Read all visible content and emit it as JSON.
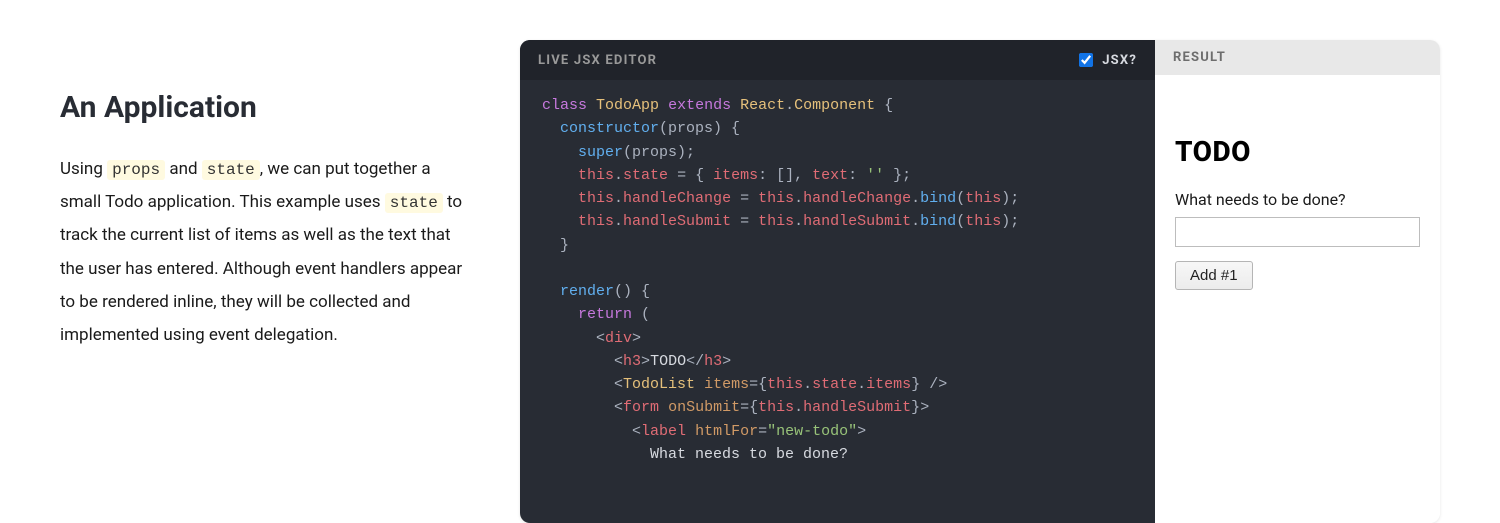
{
  "left": {
    "heading": "An Application",
    "para_pre": "Using ",
    "code1": "props",
    "para_mid1": " and ",
    "code2": "state",
    "para_mid2": ", we can put together a small Todo application. This example uses ",
    "code3": "state",
    "para_post": " to track the current list of items as well as the text that the user has entered. Although event handlers appear to be rendered inline, they will be collected and implemented using event delegation."
  },
  "editor": {
    "title": "LIVE JSX EDITOR",
    "jsx_label": "JSX?",
    "jsx_checked": true
  },
  "code": {
    "l1_kw_class": "class",
    "l1_cls": "TodoApp",
    "l1_kw_ext": "extends",
    "l1_react": "React",
    "l1_dot": ".",
    "l1_comp": "Component",
    "l1_brace": " {",
    "l2_ctor": "constructor",
    "l2_args": "(props) {",
    "l3_super": "super",
    "l3_rest": "(props);",
    "l4_this": "this",
    "l4_dot": ".",
    "l4_state": "state",
    "l4_rest1": " = { ",
    "l4_items": "items",
    "l4_rest2": ": [], ",
    "l4_text": "text",
    "l4_rest3": ": ",
    "l4_str": "''",
    "l4_rest4": " };",
    "l5_this1": "this",
    "l5_hc": "handleChange",
    "l5_eq": " = ",
    "l5_this2": "this",
    "l5_hc2": "handleChange",
    "l5_bind": "bind",
    "l5_this3": "this",
    "l6_hs": "handleSubmit",
    "l7_brace": "}",
    "l9_render": "render",
    "l9_rest": "() {",
    "l10_return": "return",
    "l10_rest": " (",
    "l11_open": "<",
    "l11_div": "div",
    "l11_close": ">",
    "l12_h3": "h3",
    "l12_txt": "TODO",
    "l13_tl": "TodoList",
    "l13_items": "items",
    "l13_eq": "=",
    "l13_ob": "{",
    "l13_this": "this",
    "l13_state": "state",
    "l13_itemsp": "items",
    "l13_cb": "}",
    "l13_end": " />",
    "l14_form": "form",
    "l14_os": "onSubmit",
    "l14_hs": "handleSubmit",
    "l15_label": "label",
    "l15_hf": "htmlFor",
    "l15_str": "\"new-todo\"",
    "l16_txt": "What needs to be done?"
  },
  "result": {
    "title": "RESULT",
    "heading": "TODO",
    "label": "What needs to be done?",
    "input_value": "",
    "button": "Add #1"
  }
}
